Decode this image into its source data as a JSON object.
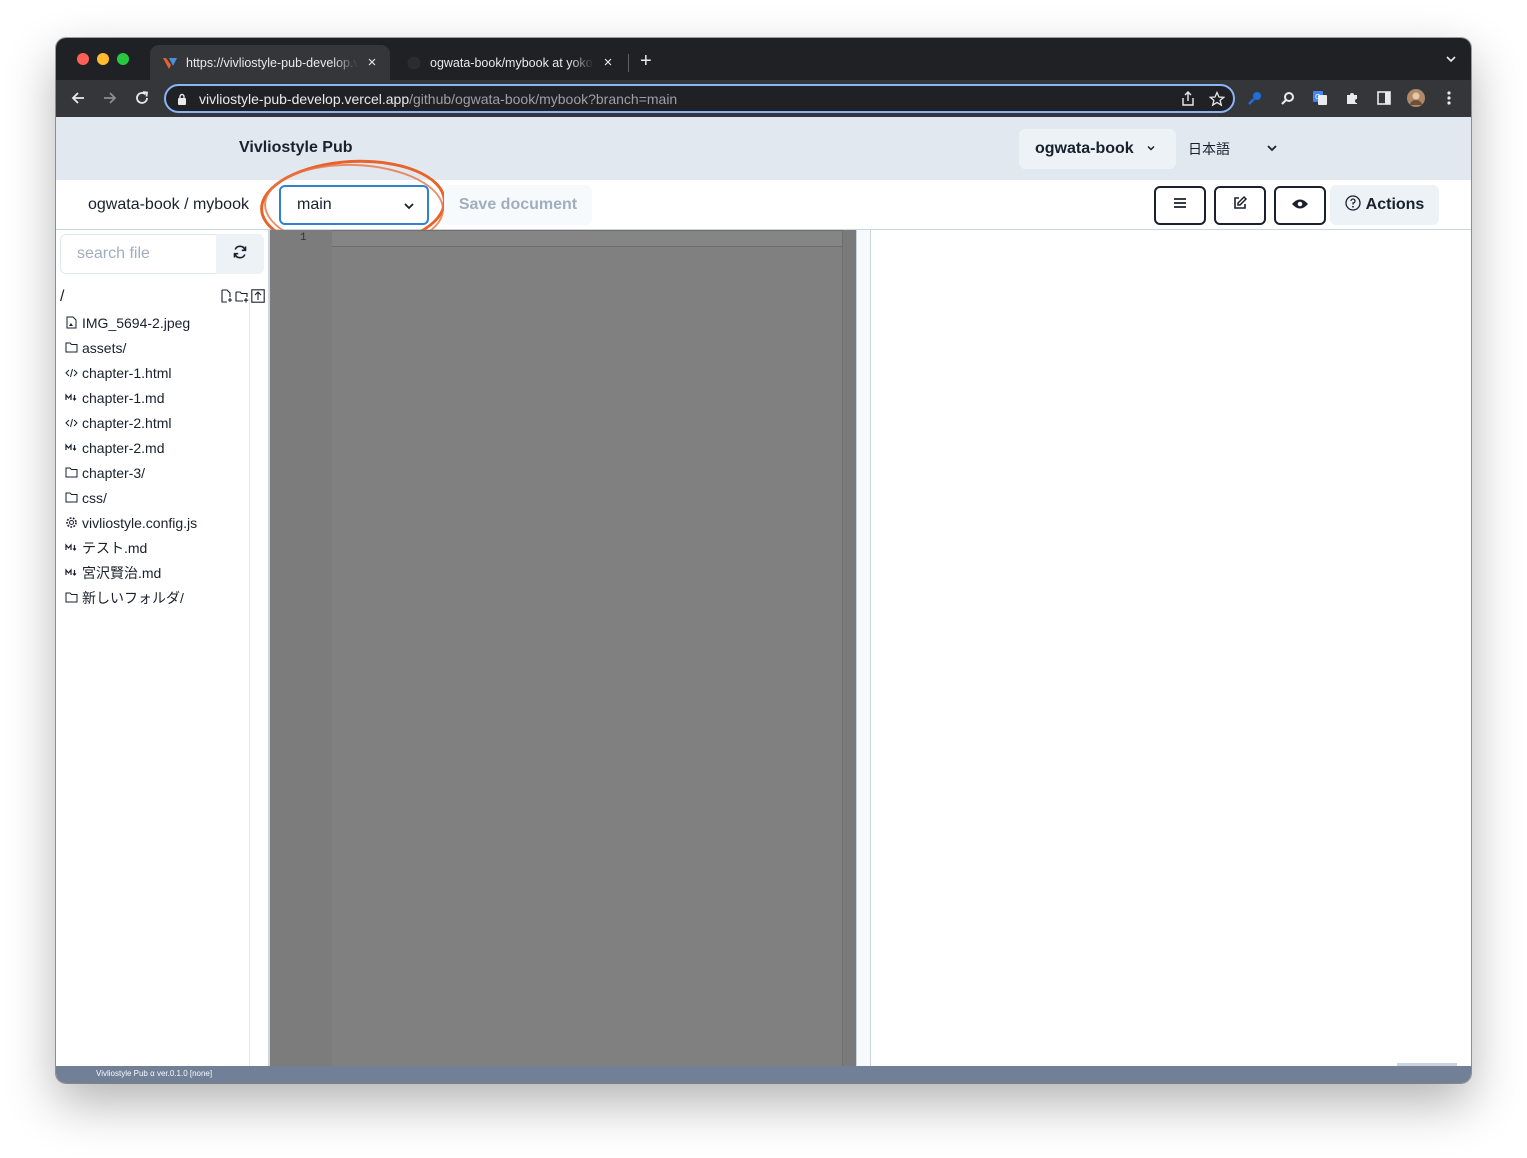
{
  "browser": {
    "tabs": [
      {
        "title": "https://vivliostyle-pub-develop.vercel.app/github/ogwata-book/mybook?branch=main",
        "active": true
      },
      {
        "title": "ogwata-book/mybook at yokosawa",
        "active": false
      }
    ],
    "new_tab_label": "+",
    "close_label": "×",
    "url_host": "vivliostyle-pub-develop.vercel.app",
    "url_path": "/github/ogwata-book/mybook?branch=main"
  },
  "header": {
    "brand": "Vivliostyle Pub",
    "user": "ogwata-book",
    "language": "日本語"
  },
  "subheader": {
    "repo_path": "ogwata-book / mybook",
    "branch": "main",
    "save_label": "Save document",
    "actions_label": "Actions"
  },
  "sidebar": {
    "search_placeholder": "search file",
    "root_label": "/",
    "files": [
      {
        "name": "IMG_5694-2.jpeg",
        "icon": "image-file-icon"
      },
      {
        "name": "assets/",
        "icon": "folder-icon"
      },
      {
        "name": "chapter-1.html",
        "icon": "code-icon"
      },
      {
        "name": "chapter-1.md",
        "icon": "markdown-icon"
      },
      {
        "name": "chapter-2.html",
        "icon": "code-icon"
      },
      {
        "name": "chapter-2.md",
        "icon": "markdown-icon"
      },
      {
        "name": "chapter-3/",
        "icon": "folder-icon"
      },
      {
        "name": "css/",
        "icon": "folder-icon"
      },
      {
        "name": "vivliostyle.config.js",
        "icon": "gear-icon"
      },
      {
        "name": "テスト.md",
        "icon": "markdown-icon"
      },
      {
        "name": "宮沢賢治.md",
        "icon": "markdown-icon"
      },
      {
        "name": "新しいフォルダ/",
        "icon": "folder-icon"
      }
    ]
  },
  "editor": {
    "line_number": "1"
  },
  "footer": {
    "version_text": "Vivliostyle Pub α ver.0.1.0 [none]"
  },
  "colors": {
    "header_bg": "#e2e8f0",
    "focus_ring": "#3182ce",
    "annotation": "#e8622a",
    "editor_bg": "#808080",
    "footer_bg": "#718096"
  }
}
